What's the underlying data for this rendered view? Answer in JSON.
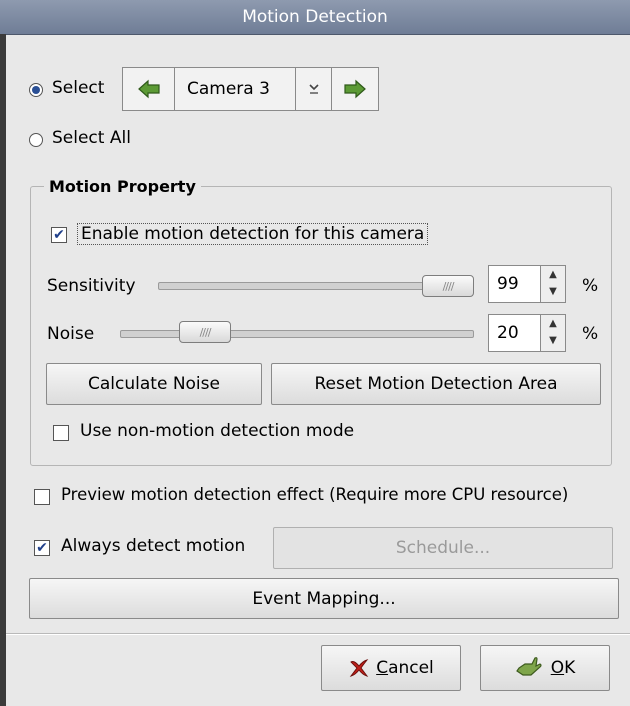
{
  "window": {
    "title": "Motion Detection"
  },
  "selection": {
    "select_label": "Select",
    "select_all_label": "Select All",
    "camera_value": "Camera 3",
    "selected_mode": "select"
  },
  "motion_property": {
    "title": "Motion Property",
    "enable_label": "Enable motion detection for this camera",
    "enable_checked": true,
    "sensitivity_label": "Sensitivity",
    "sensitivity_value": "99",
    "noise_label": "Noise",
    "noise_value": "20",
    "percent": "%",
    "calculate_noise_label": "Calculate Noise",
    "reset_area_label": "Reset Motion Detection Area",
    "non_motion_label": "Use non-motion detection mode",
    "non_motion_checked": false
  },
  "options": {
    "preview_label": "Preview motion detection effect (Require more CPU resource)",
    "preview_checked": false,
    "always_detect_label": "Always detect motion",
    "always_detect_checked": true,
    "schedule_label": "Schedule...",
    "event_mapping_label": "Event Mapping..."
  },
  "footer": {
    "cancel_prefix": "",
    "cancel_underlined": "C",
    "cancel_rest": "ancel",
    "ok_underlined": "O",
    "ok_rest": "K"
  },
  "icons": {
    "prev": "arrow-left-icon",
    "next": "arrow-right-icon",
    "dropdown": "chevron-down-icon",
    "cancel": "cancel-x-icon",
    "ok": "ok-hand-icon"
  },
  "colors": {
    "arrow_green": "#4d8a2e",
    "cancel_red": "#c0201a",
    "ok_green": "#6e9a3a",
    "titlebar": "#7f8ca3"
  }
}
